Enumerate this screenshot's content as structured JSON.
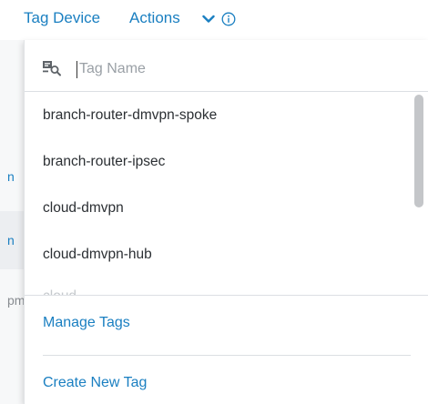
{
  "toolbar": {
    "tag_device_label": "Tag Device",
    "actions_label": "Actions",
    "actions_icon": "chevron-down-icon",
    "info_icon": "info-icon",
    "accent_color": "#1a7fc1"
  },
  "background_fragments": [
    "n",
    "n",
    "pm"
  ],
  "dropdown": {
    "search": {
      "icon": "tag-search-icon",
      "placeholder": "Tag Name",
      "value": ""
    },
    "tags": [
      "branch-router-dmvpn-spoke",
      "branch-router-ipsec",
      "cloud-dmvpn",
      "cloud-dmvpn-hub",
      "cloud-..."
    ],
    "manage_tags_label": "Manage Tags",
    "create_new_tag_label": "Create New Tag"
  }
}
